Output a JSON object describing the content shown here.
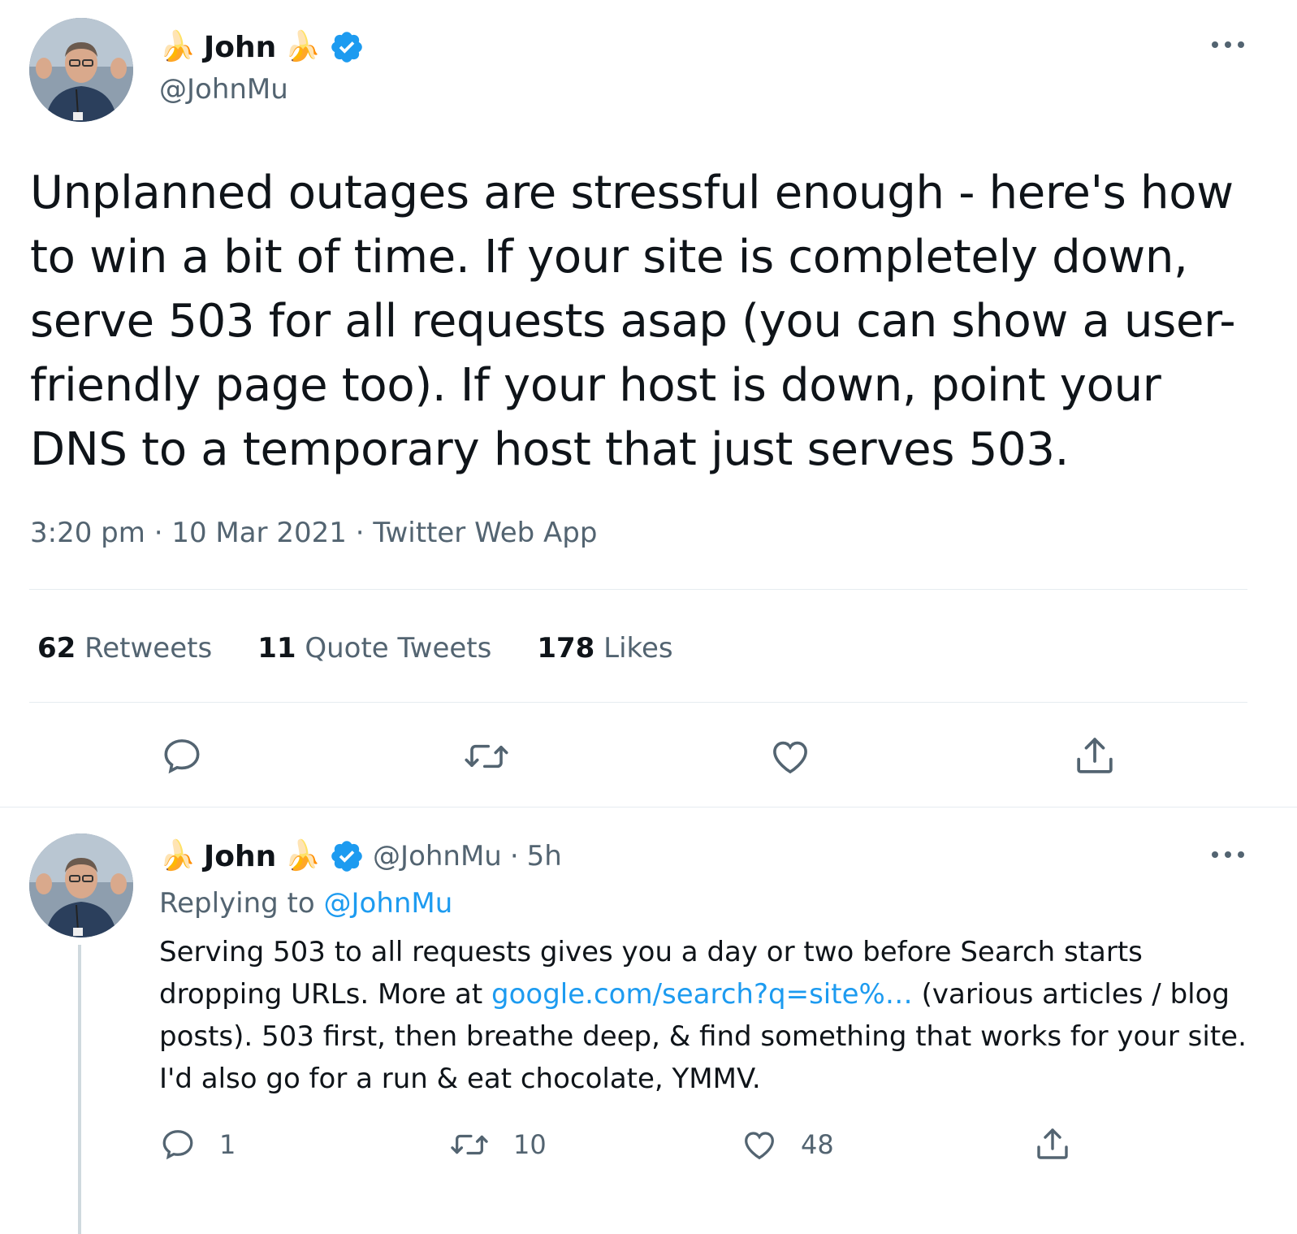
{
  "main_tweet": {
    "author": {
      "name": "John",
      "name_emoji": "🍌",
      "handle": "@JohnMu",
      "verified_icon": "verified-badge-icon",
      "avatar_icon": "avatar"
    },
    "text": "Unplanned outages are stressful enough - here's how to win a bit of time. If your site is completely down, serve 503 for all requests asap (you can show a user-friendly page too). If your host is down, point your DNS to a temporary host that just serves 503.",
    "time": "3:20 pm",
    "date": "10 Mar 2021",
    "separator": "·",
    "source": "Twitter Web App",
    "stats": {
      "retweets_count": "62",
      "retweets_label": "Retweets",
      "quotes_count": "11",
      "quotes_label": "Quote Tweets",
      "likes_count": "178",
      "likes_label": "Likes"
    },
    "actions": [
      "reply-icon",
      "retweet-icon",
      "like-icon",
      "share-icon"
    ]
  },
  "reply_tweet": {
    "author": {
      "name": "John",
      "name_emoji": "🍌",
      "handle": "@JohnMu",
      "separator": "·",
      "time_ago": "5h"
    },
    "replying_to_label": "Replying to",
    "replying_to_handle": "@JohnMu",
    "text_part1": "Serving 503 to all requests gives you a day or two before Search starts dropping URLs. More at ",
    "link": "google.com/search?q=site%…",
    "text_part2": " (various articles / blog posts). 503 first, then breathe deep, & find something that works for your site. I'd also go for a run & eat chocolate, YMMV.",
    "counts": {
      "replies": "1",
      "retweets": "10",
      "likes": "48"
    }
  },
  "colors": {
    "verified": "#1d9bf0",
    "link": "#1d9bf0",
    "secondary_text": "#536471",
    "divider": "#e6ecf0"
  }
}
